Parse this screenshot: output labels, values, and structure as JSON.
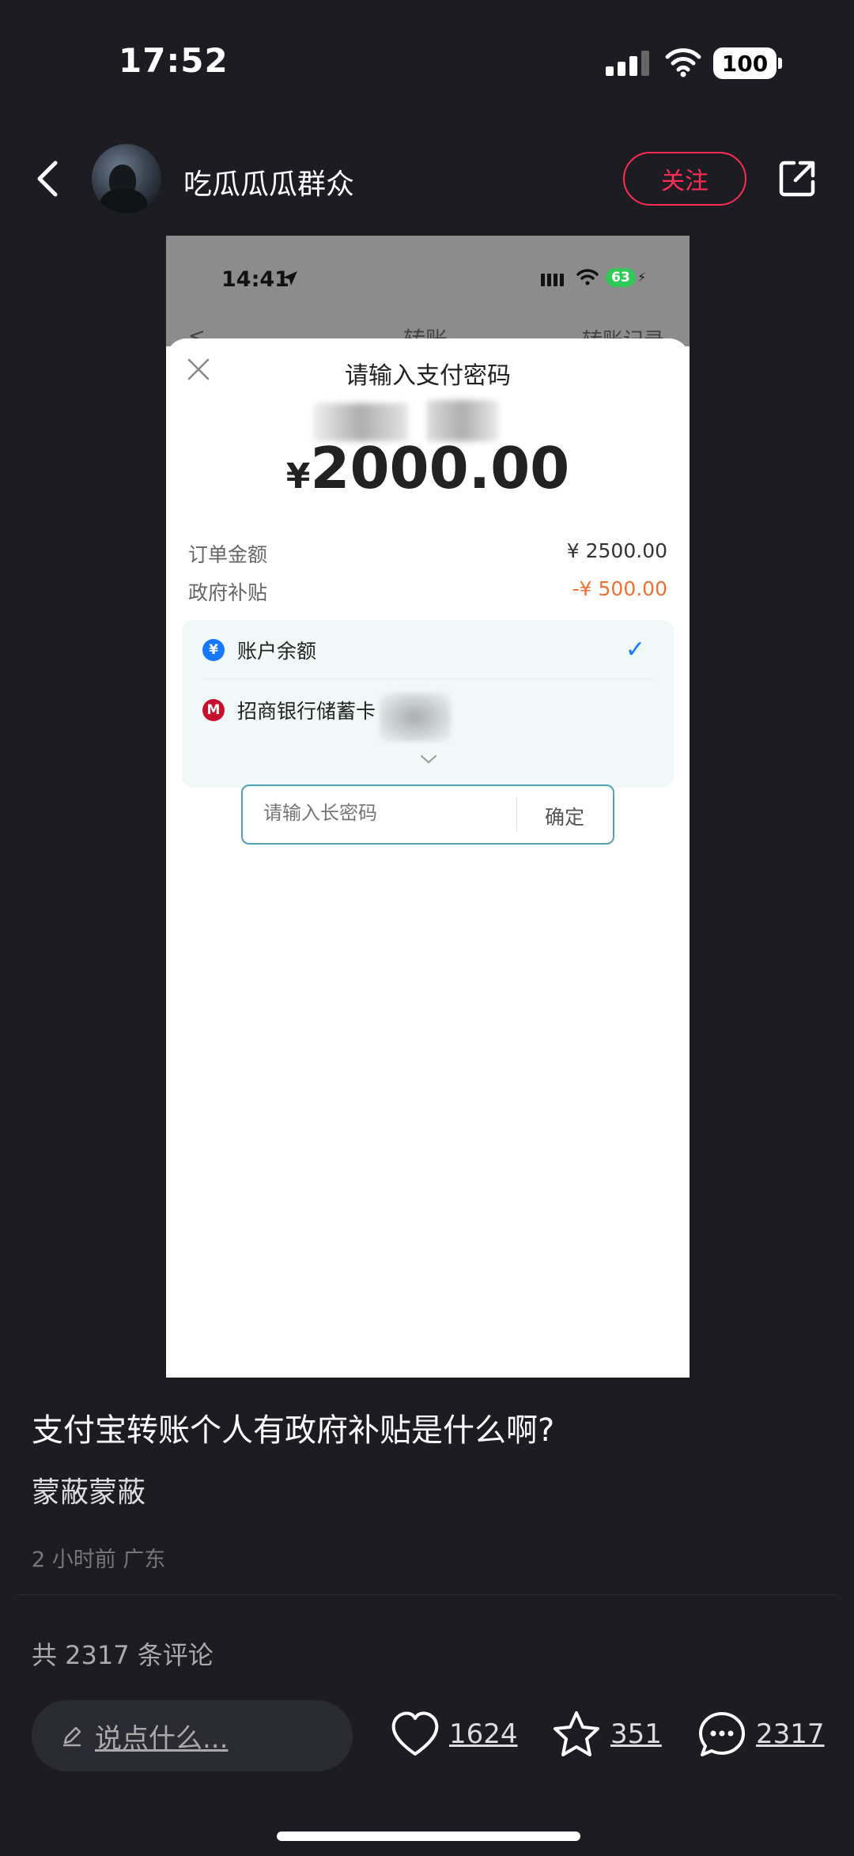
{
  "status_bar": {
    "time": "17:52",
    "battery": "100"
  },
  "header": {
    "username": "吃瓜瓜瓜群众",
    "follow_label": "关注"
  },
  "screenshot": {
    "status_time": "14:41",
    "status_battery": "63",
    "nav_back": "<",
    "nav_title": "转账",
    "nav_right": "转账记录",
    "sheet_title": "请输入支付密码",
    "amount_currency": "¥",
    "amount_value": "2000.00",
    "rows": [
      {
        "label": "订单金额",
        "value": "¥ 2500.00"
      },
      {
        "label": "政府补贴",
        "value": "-¥ 500.00"
      }
    ],
    "payment_methods": [
      {
        "label": "账户余额",
        "icon": "yuan-icon",
        "selected": true
      },
      {
        "label": "招商银行储蓄卡",
        "icon": "cmb-bank-icon",
        "selected": false
      }
    ],
    "password_placeholder": "请输入长密码",
    "confirm_label": "确定"
  },
  "post": {
    "title": "支付宝转账个人有政府补贴是什么啊?",
    "body": "蒙蔽蒙蔽",
    "meta": "2 小时前  广东",
    "comment_count_text": "共 2317 条评论"
  },
  "bottom_bar": {
    "comment_placeholder": "说点什么...",
    "likes": "1624",
    "favorites": "351",
    "comments": "2317"
  },
  "colors": {
    "accent": "#ff2d55",
    "background": "#1c1c22",
    "subsidy": "#f07032",
    "check": "#1677ff"
  }
}
